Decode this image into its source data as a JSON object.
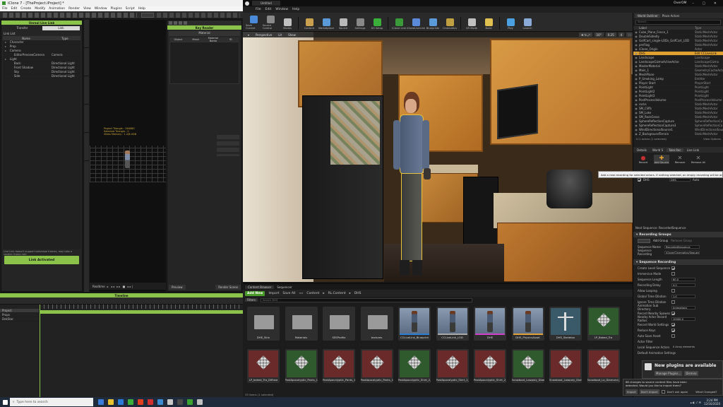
{
  "iclone": {
    "title": "iClone 7 - [TheProject.iProject] *",
    "menu": [
      "File",
      "Edit",
      "Create",
      "Modify",
      "Animation",
      "Render",
      "View",
      "Window",
      "Plugins",
      "Script",
      "Help"
    ],
    "live_link": {
      "title": "Unreal Live Link",
      "transfer_tab": "Transfer",
      "link_tab": "Link",
      "list_label": "Link List",
      "col_name": "Name",
      "col_type": "Type",
      "tree": [
        {
          "name": "Character",
          "type": ""
        },
        {
          "name": "Prop",
          "type": ""
        },
        {
          "name": "Camera",
          "type": ""
        },
        {
          "name": "EditorPreviewCamera",
          "type": "Camera"
        },
        {
          "name": "Light",
          "type": ""
        },
        {
          "name": "Back",
          "type": "Directional Light"
        },
        {
          "name": "Front Shadow",
          "type": "Directional Light"
        },
        {
          "name": "Sky",
          "type": "Directional Light"
        },
        {
          "name": "Side",
          "type": "Directional Light"
        }
      ],
      "note": "Live Link doesn't support individual frames, may take a smaller frame rate",
      "link_button": "Link Activated"
    },
    "key_reader": {
      "title": "Key Reader",
      "subtitle": "Material",
      "cols": [
        "Object",
        "Mesh",
        "Material Name",
        "ID"
      ]
    },
    "viewport_info": [
      "Project Triangle : 264080",
      "Selected Triangle : 0",
      "Video Memory : 1.2/8.0GB"
    ],
    "timeline": {
      "title": "Timeline",
      "tracks": [
        "Project",
        "Props",
        "DekStar"
      ],
      "realtime": "Realtime",
      "preview": "Preview",
      "render_scene": "Render Scene"
    }
  },
  "unreal": {
    "tab": "Untitled",
    "menu": [
      "File",
      "Edit",
      "Window",
      "Help"
    ],
    "user": "OverOM",
    "toolbar": [
      "Save Current",
      "Source Control",
      "Modes",
      "Content",
      "Marketplace",
      "Source",
      "Settings",
      "DS Setup",
      "iClone Link",
      "iCloneLiveLink",
      "Blueprints",
      "Cinematics",
      "VR Mode",
      "Build",
      "Play",
      "Launch"
    ],
    "viewport": {
      "perspective": "Perspective",
      "lit": "Lit",
      "show": "Show",
      "fov": "10°",
      "scale": "0.25",
      "cam": "4"
    },
    "world_outliner": {
      "title": "World Outliner",
      "place_tab": "Place Actors",
      "search": "Search...",
      "col_label": "Label",
      "col_type": "Type",
      "items": [
        {
          "label": "Cube_Plane_Fence_1",
          "type": "StaticMeshActor"
        },
        {
          "label": "DoubleSidedly",
          "type": "StaticMeshActor"
        },
        {
          "label": "GolfCart_single-LODs_GolfCart_LOD",
          "type": "StaticMeshActor"
        },
        {
          "label": "preFlag",
          "type": "StaticMeshActor"
        },
        {
          "label": "iClone_Origin",
          "type": "Actor"
        },
        {
          "label": "DHS",
          "type": "Edit CCLiveLink"
        },
        {
          "label": "Landscape",
          "type": "Landscape"
        },
        {
          "label": "LandscapeGizmoActiveActor",
          "type": "LandscapeGizmo"
        },
        {
          "label": "MasterMaterial",
          "type": "StaticMeshActor"
        },
        {
          "label": "Main_1",
          "type": "GeometryCacheActor"
        },
        {
          "label": "MeshPlane",
          "type": "StaticMeshActor"
        },
        {
          "label": "P_Smoking_Lamp",
          "type": "Emitter"
        },
        {
          "label": "Player Start",
          "type": "PlayerStart"
        },
        {
          "label": "PointLight",
          "type": "PointLight"
        },
        {
          "label": "PointLight2",
          "type": "PointLight"
        },
        {
          "label": "PointLight3",
          "type": "PointLight"
        },
        {
          "label": "PostProcessVolume",
          "type": "PostProcessVolume"
        },
        {
          "label": "rocks",
          "type": "StaticMeshActor"
        },
        {
          "label": "SM_Cliffs",
          "type": "StaticMeshActor"
        },
        {
          "label": "SM_Lake",
          "type": "StaticMeshActor"
        },
        {
          "label": "SM_RockGrass",
          "type": "StaticMeshActor"
        },
        {
          "label": "SphereReflectionCapture",
          "type": "SphereReflectionCa"
        },
        {
          "label": "SphereReflectionCapture3",
          "type": "SphereReflectionCa"
        },
        {
          "label": "WindDirectionalSource1",
          "type": "WindDirectionalSour"
        },
        {
          "label": "Z_BackgroundTerrain",
          "type": "StaticMeshActor"
        }
      ],
      "footer": "111 actors (1 selected)",
      "view_options": "View Options"
    },
    "details_tabs": [
      "Details",
      "World S",
      "Take Rec",
      "Live Link"
    ],
    "take_recorder": {
      "buttons": [
        "Record",
        "Add Source",
        "Remove",
        "Remove All"
      ],
      "tooltip": "Add a new recording for selected actors. If nothing selected, an empty recording will be added",
      "sources": [
        {
          "name": "iClone_Origin",
          "take": "iClone_Origin",
          "mode": "Auto"
        },
        {
          "name": "DHS",
          "take": "DHS",
          "mode": "Auto"
        }
      ],
      "next_seq": "Next Sequence: RecordedSequence",
      "recording_groups": "Recording Groups",
      "add_group": "Add Group",
      "remove_group": "Remove Group",
      "seq_name_label": "Sequence Name",
      "seq_name": "RecordedSequence",
      "seq_rec_label": "Sequence Recording",
      "seq_rec": "iClone/Cinematics/Sequences"
    },
    "sequence_recording": {
      "title": "Sequence Recording",
      "props": [
        {
          "k": "Create Level Sequence",
          "v": "check"
        },
        {
          "k": "Immersive Mode",
          "v": "uncheck"
        },
        {
          "k": "Sequence Length",
          "v": "60.0"
        },
        {
          "k": "Recording Delay",
          "v": "4.0"
        },
        {
          "k": "Allow Looping",
          "v": "uncheck"
        },
        {
          "k": "Global Time Dilation",
          "v": "1.0"
        },
        {
          "k": "Ignore Time Dilation",
          "v": "uncheck"
        },
        {
          "k": "Animation Sub Directory",
          "v": "Animations"
        },
        {
          "k": "Record Nearby Spawns",
          "v": "check"
        },
        {
          "k": "Nearby Actor Record Radius",
          "v": "10000.0"
        },
        {
          "k": "Record World Settings",
          "v": "check"
        },
        {
          "k": "Reduce Keys",
          "v": "check"
        },
        {
          "k": "Auto Save Asset",
          "v": "uncheck"
        }
      ],
      "actor_filter": "Actor Filter",
      "local_seq_actor": "Local Sequence Actors",
      "local_seq_val": "0 Array elements",
      "default_anim": "Default Animation Settings"
    },
    "content_browser": {
      "title": "Content Browser",
      "seq_tab": "Sequencer",
      "add_new": "Add New",
      "import": "Import",
      "save_all": "Save All",
      "path": [
        "Content",
        "RL.Content",
        "DHS"
      ],
      "filters": "Filters",
      "search": "Search DHS",
      "row1": [
        {
          "name": "DHS_Skin",
          "kind": "folder"
        },
        {
          "name": "Materials",
          "kind": "folder"
        },
        {
          "name": "SSSProfile",
          "kind": "folder"
        },
        {
          "name": "textures",
          "kind": "folder"
        },
        {
          "name": "CCLiveLink_Blueprint",
          "kind": "char",
          "color": "#2d7fd1"
        },
        {
          "name": "CCLiveLink_LOD",
          "kind": "char",
          "color": "#aaaaaa"
        },
        {
          "name": "DHS",
          "kind": "char",
          "color": "#d040c8"
        },
        {
          "name": "DHS_PhysicsAsset",
          "kind": "char",
          "color": "#e2a23a"
        },
        {
          "name": "DHS_Skeleton",
          "kind": "skel",
          "color": "#3aa0d8"
        },
        {
          "name": "LP_Baked_Tra",
          "kind": "tex",
          "color": "#5a9a3a"
        }
      ],
      "row2": [
        {
          "name": "LP_baked_Tra_Diffuse",
          "kind": "mat"
        },
        {
          "name": "PostApocalyptic_Pants_1_MAT_Pre_Diffuse",
          "kind": "tex"
        },
        {
          "name": "PostApocalyptic_Pants_1_MAT_Pre_Normal",
          "kind": "mat"
        },
        {
          "name": "PostApocalyptic_Pants_1_MAT_Pre_Specul",
          "kind": "mat"
        },
        {
          "name": "PostApocalyptic_Shirt_2_MAT_Pre_Diffuse",
          "kind": "tex"
        },
        {
          "name": "PostApocalyptic_Shirt_2_MAT_Pre_Normal",
          "kind": "mat"
        },
        {
          "name": "PostApocalyptic_Shirt_2_MAT_Pre_Specul",
          "kind": "mat"
        },
        {
          "name": "Snowboot_Lowpoly_Diamond_Baked_Tra",
          "kind": "tex"
        },
        {
          "name": "Snowboot_Lowpoly_Diamond_Baked_Tra",
          "kind": "mat"
        },
        {
          "name": "Snowboot_Lo_Diamond_Bake",
          "kind": "mat"
        }
      ],
      "footer": "33 items (1 selected)",
      "view_options": "View Options"
    },
    "notification": {
      "title": "New plugins are available",
      "button": "Manage Plugins...",
      "dismiss": "Dismiss"
    },
    "import_toast": {
      "text": "68 changes to source content files have been detected. Would you like to import them?",
      "import": "Import",
      "dont": "Don't Import",
      "dontask": "Don't ask again",
      "what": "What Changed?"
    }
  },
  "taskbar": {
    "search": "Type here to search",
    "time": "3:24 PM",
    "date": "12/16/2020"
  }
}
